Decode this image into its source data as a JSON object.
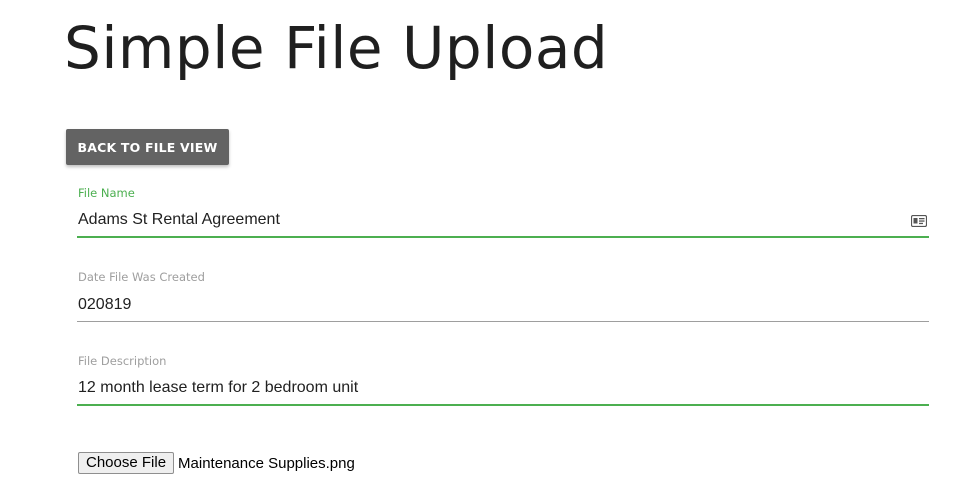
{
  "page": {
    "title": "Simple File Upload"
  },
  "toolbar": {
    "back_label": "BACK TO FILE VIEW"
  },
  "form": {
    "file_name": {
      "label": "File Name",
      "value": "Adams St Rental Agreement",
      "icon": "contact-card-icon"
    },
    "date_created": {
      "label": "Date File Was Created",
      "value": "020819"
    },
    "description": {
      "label": "File Description",
      "value": "12 month lease term for 2 bedroom unit"
    },
    "file_upload": {
      "button_label": "Choose File",
      "selected_file": "Maintenance Supplies.png"
    }
  },
  "colors": {
    "accent": "#4caf50",
    "button_bg": "#636363",
    "inactive_label": "#9e9e9e"
  }
}
